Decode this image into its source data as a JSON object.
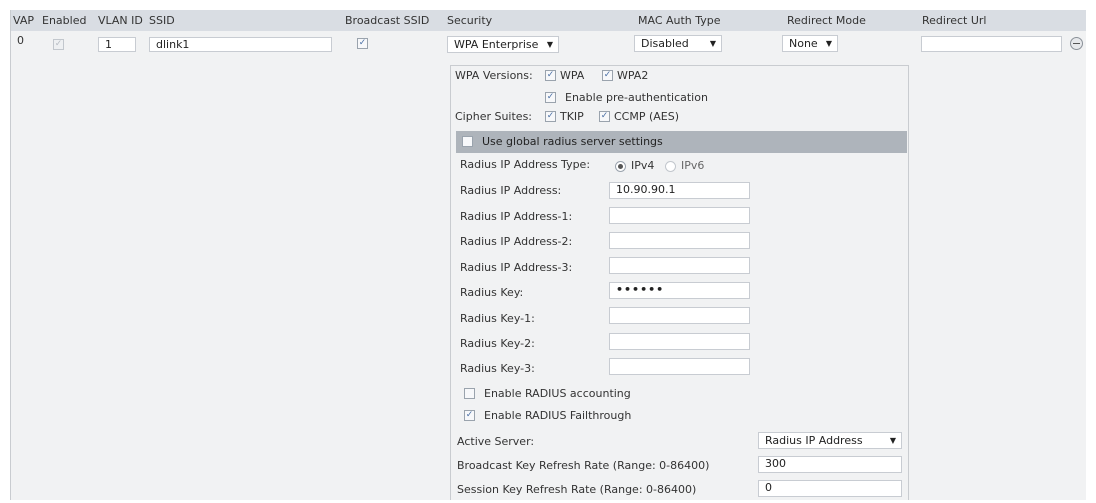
{
  "headers": {
    "vap": "VAP",
    "enabled": "Enabled",
    "vlan_id": "VLAN ID",
    "ssid": "SSID",
    "broadcast_ssid": "Broadcast SSID",
    "security": "Security",
    "mac_auth_type": "MAC Auth Type",
    "redirect_mode": "Redirect Mode",
    "redirect_url": "Redirect Url"
  },
  "row": {
    "vap": "0",
    "enabled_checked": true,
    "vlan_id": "1",
    "ssid": "dlink1",
    "broadcast_ssid_checked": true,
    "security": "WPA Enterprise",
    "mac_auth_type": "Disabled",
    "redirect_mode": "None",
    "redirect_url": ""
  },
  "wpa": {
    "versions_label": "WPA Versions:",
    "wpa_label": "WPA",
    "wpa_checked": true,
    "wpa2_label": "WPA2",
    "wpa2_checked": true,
    "preauth_label": "Enable pre-authentication",
    "preauth_checked": true,
    "cipher_label": "Cipher Suites:",
    "tkip_label": "TKIP",
    "tkip_checked": true,
    "ccmp_label": "CCMP (AES)",
    "ccmp_checked": true
  },
  "radius": {
    "use_global_label": "Use global radius server settings",
    "use_global_checked": false,
    "ip_type_label": "Radius IP Address Type:",
    "ipv4_label": "IPv4",
    "ipv6_label": "IPv6",
    "ip_type_selected": "IPv4",
    "fields": [
      {
        "label": "Radius IP Address:",
        "value": "10.90.90.1"
      },
      {
        "label": "Radius IP Address-1:",
        "value": ""
      },
      {
        "label": "Radius IP Address-2:",
        "value": ""
      },
      {
        "label": "Radius IP Address-3:",
        "value": ""
      },
      {
        "label": "Radius Key:",
        "value": "••••••"
      },
      {
        "label": "Radius Key-1:",
        "value": ""
      },
      {
        "label": "Radius Key-2:",
        "value": ""
      },
      {
        "label": "Radius Key-3:",
        "value": ""
      }
    ],
    "accounting_label": "Enable RADIUS accounting",
    "accounting_checked": false,
    "failthrough_label": "Enable RADIUS Failthrough",
    "failthrough_checked": true,
    "active_server_label": "Active Server:",
    "active_server_value": "Radius IP Address",
    "bcast_refresh_label": "Broadcast Key Refresh Rate (Range: 0-86400)",
    "bcast_refresh_value": "300",
    "session_refresh_label": "Session Key Refresh Rate (Range: 0-86400)",
    "session_refresh_value": "0"
  },
  "colors": {
    "header_bg": "#d9dde3",
    "content_bg": "#f1f2f3",
    "global_bar_bg": "#aeb4bb",
    "check_color": "#4a6fa5"
  },
  "icons": {
    "remove": "remove-circle-icon",
    "dropdown": "chevron-down-icon",
    "check": "check-icon"
  }
}
